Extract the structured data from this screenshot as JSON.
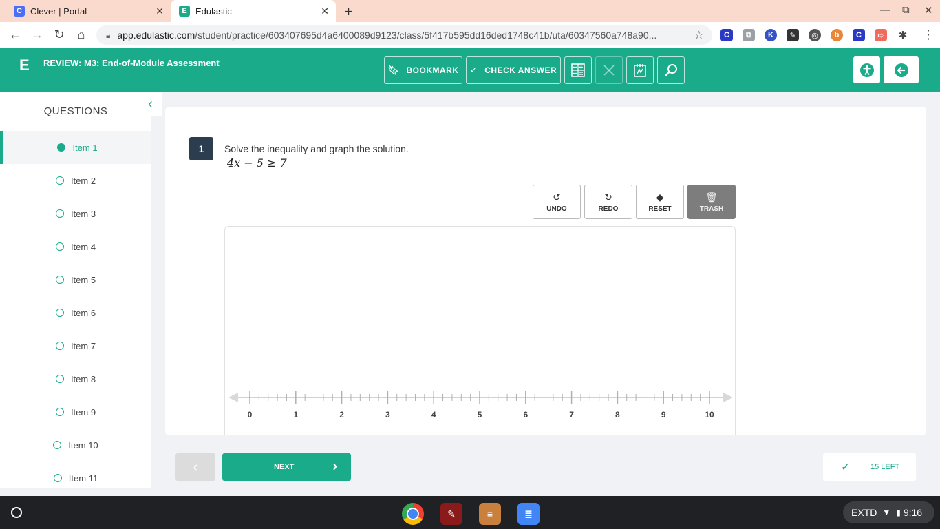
{
  "browser": {
    "tabs": [
      {
        "title": "Clever | Portal",
        "favicon": "C"
      },
      {
        "title": "Edulastic",
        "favicon": "E"
      }
    ],
    "new_tab": "+",
    "url_domain": "app.edulastic.com",
    "url_path": "/student/practice/603407695d4a6400089d9123/class/5f417b595dd16ded1748c41b/uta/60347560a748a90...",
    "extensions": [
      "C",
      "⧉",
      "K",
      "✎",
      "◎",
      "b",
      "C",
      "➪",
      "✱"
    ]
  },
  "header": {
    "logo": "E",
    "title": "REVIEW: M3: End-of-Module Assessment",
    "bookmark_label": "BOOKMARK",
    "check_answer_label": "CHECK ANSWER"
  },
  "sidebar": {
    "title": "QUESTIONS",
    "items": [
      {
        "label": "Item 1"
      },
      {
        "label": "Item 2"
      },
      {
        "label": "Item 3"
      },
      {
        "label": "Item 4"
      },
      {
        "label": "Item 5"
      },
      {
        "label": "Item 6"
      },
      {
        "label": "Item 7"
      },
      {
        "label": "Item 8"
      },
      {
        "label": "Item 9"
      },
      {
        "label": "Item 10"
      },
      {
        "label": "Item 11"
      }
    ],
    "active_index": 0
  },
  "question": {
    "number": "1",
    "prompt": "Solve the inequality and graph the solution.",
    "math": "4x − 5 ≥ 7"
  },
  "tools": {
    "undo": "UNDO",
    "redo": "REDO",
    "reset": "RESET",
    "trash": "TRASH"
  },
  "number_line": {
    "min": 0,
    "max": 10,
    "labels": [
      "0",
      "1",
      "2",
      "3",
      "4",
      "5",
      "6",
      "7",
      "8",
      "9",
      "10"
    ],
    "minor_ticks_per_unit": 4
  },
  "footer": {
    "next_label": "NEXT",
    "left_label": "15 LEFT"
  },
  "shelf": {
    "tray_text": "EXTD",
    "time": "9:16"
  },
  "colors": {
    "accent": "#1aab8a",
    "question_badge": "#2b3d4f",
    "tab_strip": "#f9dacd"
  }
}
